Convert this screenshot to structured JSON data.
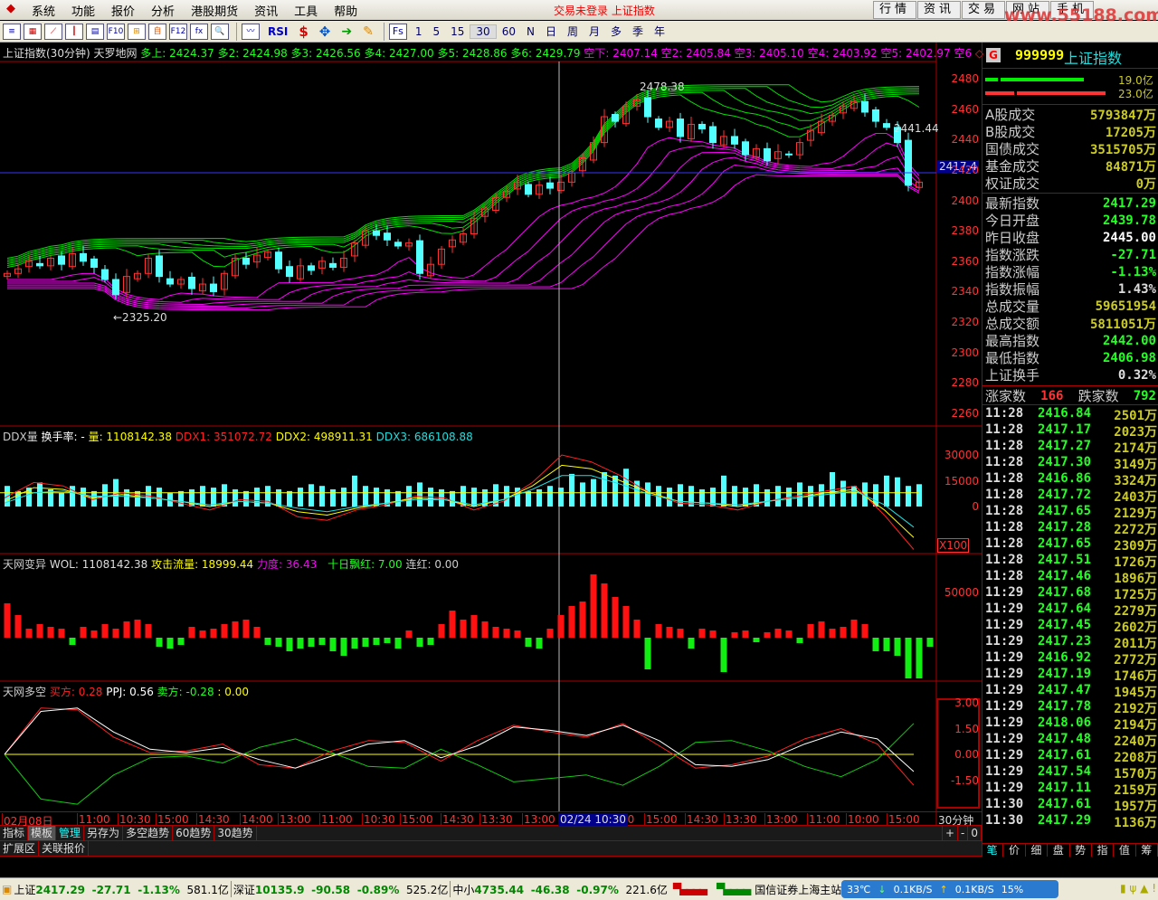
{
  "menu": {
    "items": [
      "系统",
      "功能",
      "报价",
      "分析",
      "港股期货",
      "资讯",
      "工具",
      "帮助"
    ],
    "warning": "交易未登录  上证指数",
    "nav": [
      "行情",
      "资讯",
      "交易",
      "网站",
      "手机"
    ],
    "watermark": "www.55188.com"
  },
  "toolbar": {
    "periods": [
      "1",
      "5",
      "15",
      "30",
      "60",
      "N",
      "日",
      "周",
      "月",
      "多",
      "季",
      "年"
    ],
    "selected_period": "30",
    "fs_label": "Fs",
    "rsi_label": "RSI"
  },
  "main_header": {
    "title": "上证指数(30分钟) 天罗地网",
    "bulls": [
      "多上: 2424.37",
      "多2: 2424.98",
      "多3: 2426.56",
      "多4: 2427.00",
      "多5: 2428.86",
      "多6: 2429.79"
    ],
    "bears": [
      "空下: 2407.14",
      "空2: 2405.84",
      "空3: 2405.10",
      "空4: 2403.92",
      "空5: 2402.97",
      "空6"
    ]
  },
  "ddx_header": {
    "name": "DDX量",
    "turnover": "换手率: -",
    "vol": "量: 1108142.38",
    "ddx1": "DDX1: 351072.72",
    "ddx2": "DDX2: 498911.31",
    "ddx3": "DDX3: 686108.88"
  },
  "wol_header": {
    "name": "天网变异",
    "wol": "WOL: 1108142.38",
    "attack": "攻击流量: 18999.44",
    "force": "力度: 36.43",
    "red10": "十日飘红: 7.00",
    "streak": "连红: 0.00"
  },
  "ppj_header": {
    "name": "天网多空",
    "buy": "买方: 0.28",
    "ppj": "PPJ: 0.56",
    "sell": "卖方: -0.28",
    "zero": ": 0.00"
  },
  "annotations": {
    "high": "2478.38",
    "low": "←2325.20",
    "right": "2441.44",
    "cursor_price": "2417.4"
  },
  "colors": {
    "up": "#ff3232",
    "down": "#54ffff",
    "bull": "#00e000",
    "bear": "#ff00ff",
    "axis": "#ff3333"
  },
  "chart_data": [
    {
      "type": "candlestick",
      "title": "上证指数(30分钟)",
      "y_ticks": [
        2480,
        2460,
        2440,
        2420,
        2400,
        2380,
        2360,
        2340,
        2320,
        2300,
        2280,
        2260
      ],
      "ylim": [
        2260,
        2480
      ],
      "close": [
        2352,
        2355,
        2360,
        2357,
        2362,
        2358,
        2365,
        2360,
        2356,
        2348,
        2338,
        2350,
        2352,
        2362,
        2350,
        2345,
        2348,
        2342,
        2345,
        2340,
        2352,
        2362,
        2358,
        2364,
        2366,
        2355,
        2350,
        2357,
        2354,
        2360,
        2356,
        2362,
        2372,
        2380,
        2377,
        2374,
        2370,
        2372,
        2352,
        2358,
        2368,
        2374,
        2378,
        2388,
        2395,
        2402,
        2406,
        2412,
        2404,
        2410,
        2408,
        2412,
        2418,
        2428,
        2438,
        2455,
        2452,
        2462,
        2466,
        2455,
        2448,
        2452,
        2442,
        2450,
        2447,
        2438,
        2442,
        2437,
        2430,
        2434,
        2426,
        2432,
        2430,
        2438,
        2446,
        2452,
        2456,
        2462,
        2465,
        2458,
        2452,
        2448,
        2438,
        2410,
        2412
      ]
    },
    {
      "type": "bar+line",
      "title": "DDX量",
      "y_ticks": [
        30000,
        15000,
        0
      ],
      "scale_label": "X100",
      "volume": [
        12000,
        9000,
        11000,
        14000,
        10000,
        8000,
        12000,
        11000,
        9000,
        13000,
        16000,
        10000,
        9000,
        12000,
        11000,
        8000,
        9000,
        10000,
        12000,
        11000,
        13000,
        10000,
        9000,
        11000,
        12000,
        10000,
        9000,
        11000,
        13000,
        12000,
        10000,
        11000,
        18000,
        12000,
        11000,
        10000,
        9000,
        12000,
        14000,
        11000,
        10000,
        9000,
        12000,
        11000,
        10000,
        13000,
        12000,
        11000,
        9000,
        10000,
        12000,
        11000,
        19000,
        14000,
        16000,
        20000,
        18000,
        22000,
        15000,
        14000,
        12000,
        11000,
        13000,
        12000,
        10000,
        11000,
        18000,
        12000,
        11000,
        13000,
        10000,
        12000,
        11000,
        14000,
        12000,
        13000,
        20000,
        15000,
        12000,
        14000,
        13000,
        18000,
        17000,
        12000,
        13000
      ],
      "ddx1": [
        5000,
        14000,
        12000,
        4000,
        8000,
        6000,
        2000,
        -2000,
        4000,
        3000,
        -6000,
        -8000,
        -2000,
        1000,
        6000,
        5000,
        -2000,
        3000,
        14000,
        30000,
        26000,
        18000,
        8000,
        2000,
        1000,
        -2000,
        3000,
        6000,
        9000,
        12000,
        -5000,
        -25000
      ],
      "ddx2": [
        3000,
        11000,
        10000,
        5000,
        7000,
        5000,
        3000,
        0,
        3000,
        2000,
        -3000,
        -5000,
        -1000,
        2000,
        5000,
        4000,
        0,
        4000,
        12000,
        24000,
        22000,
        15000,
        8000,
        3000,
        2000,
        0,
        3000,
        5000,
        8000,
        10000,
        -2000,
        -18000
      ],
      "ddx3": [
        2000,
        8000,
        9000,
        6000,
        6000,
        5000,
        3000,
        1000,
        3000,
        2000,
        -1000,
        -3000,
        0,
        2000,
        4000,
        4000,
        1000,
        4000,
        10000,
        18000,
        18000,
        13000,
        7000,
        3000,
        2000,
        1000,
        3000,
        5000,
        7000,
        9000,
        1000,
        -12000
      ],
      "ma_line": 8000
    },
    {
      "type": "bar",
      "title": "天网变异",
      "y_ticks": [
        50000
      ],
      "values": [
        38000,
        25000,
        10000,
        15000,
        12000,
        10000,
        -8000,
        12000,
        8000,
        15000,
        10000,
        18000,
        20000,
        15000,
        -10000,
        -12000,
        -8000,
        12000,
        8000,
        10000,
        15000,
        18000,
        20000,
        12000,
        -8000,
        -10000,
        -15000,
        -12000,
        -10000,
        -8000,
        -15000,
        -20000,
        -12000,
        -10000,
        -8000,
        -6000,
        -12000,
        8000,
        -10000,
        -8000,
        15000,
        30000,
        20000,
        25000,
        18000,
        12000,
        10000,
        8000,
        -10000,
        -12000,
        10000,
        25000,
        35000,
        40000,
        70000,
        60000,
        45000,
        35000,
        20000,
        -35000,
        15000,
        12000,
        10000,
        -12000,
        10000,
        8000,
        -38000,
        6000,
        8000,
        -5000,
        6000,
        10000,
        8000,
        -6000,
        15000,
        18000,
        10000,
        12000,
        20000,
        15000,
        -15000,
        -15000,
        -20000,
        -45000,
        -45000,
        -10000
      ]
    },
    {
      "type": "line",
      "title": "天网多空",
      "y_ticks": [
        3.0,
        1.5,
        0.0,
        -1.5
      ],
      "zero_line": 0,
      "buy": [
        0,
        2.7,
        2.6,
        1.0,
        0.1,
        0.2,
        0.6,
        -0.6,
        -0.8,
        0.2,
        0.8,
        0.7,
        -0.4,
        0.8,
        1.7,
        1.3,
        1.0,
        1.8,
        0.5,
        -0.8,
        -0.6,
        -0.1,
        0.9,
        1.5,
        0.6,
        -1.8
      ],
      "ppj": [
        0,
        2.5,
        2.7,
        1.3,
        0.3,
        0.1,
        0.4,
        -0.3,
        -0.8,
        -0.1,
        0.6,
        0.8,
        -0.2,
        0.5,
        1.6,
        1.4,
        1.1,
        1.7,
        0.8,
        -0.6,
        -0.7,
        -0.3,
        0.6,
        1.3,
        0.9,
        -1.0
      ],
      "sell": [
        0,
        -2.6,
        -2.9,
        -1.2,
        -0.2,
        -0.1,
        -0.5,
        0.4,
        0.9,
        0.1,
        -0.7,
        -0.8,
        0.3,
        -0.6,
        -1.6,
        -1.4,
        -1.2,
        -1.8,
        -0.7,
        0.7,
        0.8,
        0.2,
        -0.7,
        -1.3,
        -0.3,
        1.8
      ]
    }
  ],
  "time_axis": {
    "labels": [
      "02月08日",
      "11:00",
      "10:30",
      "15:00",
      "14:30",
      "14:00",
      "13:00",
      "11:00",
      "10:30",
      "15:00",
      "14:30",
      "13:30",
      "13:00",
      "00",
      "15:00",
      "14:30",
      "13:30",
      "13:00",
      "11:00",
      "10:00",
      "15:00"
    ],
    "cursor": "02/24 10:30",
    "period": "30分钟"
  },
  "bottom_tabs": {
    "row1": [
      "指标",
      "模板",
      "管理",
      "另存为",
      "多空趋势",
      "60趋势",
      "30趋势"
    ],
    "row2": [
      "扩展区",
      "关联报价"
    ],
    "zoom": [
      "+",
      "-",
      "0"
    ]
  },
  "right_panel": {
    "badge": "G",
    "code": "999999",
    "name": "上证指数",
    "bar_labels": [
      "19.0亿",
      "23.0亿"
    ],
    "volumes": [
      {
        "label": "A股成交",
        "value": "5793847万"
      },
      {
        "label": "B股成交",
        "value": "17205万"
      },
      {
        "label": "国债成交",
        "value": "3515705万"
      },
      {
        "label": "基金成交",
        "value": "84871万"
      },
      {
        "label": "权证成交",
        "value": "0万"
      }
    ],
    "stats": [
      {
        "label": "最新指数",
        "value": "2417.29",
        "color": "#2f2"
      },
      {
        "label": "今日开盘",
        "value": "2439.78",
        "color": "#2f2"
      },
      {
        "label": "昨日收盘",
        "value": "2445.00",
        "color": "#fff"
      },
      {
        "label": "指数涨跌",
        "value": "-27.71",
        "color": "#2f2"
      },
      {
        "label": "指数涨幅",
        "value": "-1.13%",
        "color": "#2f2"
      },
      {
        "label": "指数振幅",
        "value": "1.43%",
        "color": "#ddd"
      },
      {
        "label": "总成交量",
        "value": "59651954",
        "color": "#cc2"
      },
      {
        "label": "总成交额",
        "value": "5811051万",
        "color": "#cc2"
      },
      {
        "label": "最高指数",
        "value": "2442.00",
        "color": "#2f2"
      },
      {
        "label": "最低指数",
        "value": "2406.98",
        "color": "#2f2"
      },
      {
        "label": "上证换手",
        "value": "0.32%",
        "color": "#ddd"
      }
    ],
    "breadth": {
      "up_label": "涨家数",
      "up": "166",
      "down_label": "跌家数",
      "down": "792"
    },
    "ticks": [
      [
        "11:28",
        "2416.84",
        "2501万"
      ],
      [
        "11:28",
        "2417.17",
        "2023万"
      ],
      [
        "11:28",
        "2417.27",
        "2174万"
      ],
      [
        "11:28",
        "2417.30",
        "3149万"
      ],
      [
        "11:28",
        "2416.86",
        "3324万"
      ],
      [
        "11:28",
        "2417.72",
        "2403万"
      ],
      [
        "11:28",
        "2417.65",
        "2129万"
      ],
      [
        "11:28",
        "2417.28",
        "2272万"
      ],
      [
        "11:28",
        "2417.65",
        "2309万"
      ],
      [
        "11:28",
        "2417.51",
        "1726万"
      ],
      [
        "11:28",
        "2417.46",
        "1896万"
      ],
      [
        "11:29",
        "2417.68",
        "1725万"
      ],
      [
        "11:29",
        "2417.64",
        "2279万"
      ],
      [
        "11:29",
        "2417.45",
        "2602万"
      ],
      [
        "11:29",
        "2417.23",
        "2011万"
      ],
      [
        "11:29",
        "2416.92",
        "2772万"
      ],
      [
        "11:29",
        "2417.19",
        "1746万"
      ],
      [
        "11:29",
        "2417.47",
        "1945万"
      ],
      [
        "11:29",
        "2417.78",
        "2192万"
      ],
      [
        "11:29",
        "2418.06",
        "2194万"
      ],
      [
        "11:29",
        "2417.48",
        "2240万"
      ],
      [
        "11:29",
        "2417.61",
        "2208万"
      ],
      [
        "11:29",
        "2417.54",
        "1570万"
      ],
      [
        "11:29",
        "2417.11",
        "2159万"
      ],
      [
        "11:30",
        "2417.61",
        "1957万"
      ],
      [
        "11:30",
        "2417.29",
        "1136万"
      ]
    ],
    "tabs": [
      "笔",
      "价",
      "细",
      "盘",
      "势",
      "指",
      "值",
      "筹"
    ]
  },
  "status": {
    "sh": {
      "name": "上证",
      "price": "2417.29",
      "chg": "-27.71",
      "pct": "-1.13%",
      "amt": "581.1亿"
    },
    "sz": {
      "name": "深证",
      "price": "10135.9",
      "chg": "-90.58",
      "pct": "-0.89%",
      "amt": "525.2亿"
    },
    "zx": {
      "name": "中小",
      "price": "4735.44",
      "chg": "-46.38",
      "pct": "-0.97%",
      "amt": "221.6亿"
    },
    "server": "国信证券上海主站",
    "temp": "33℃",
    "down_speed": "0.1KB/S",
    "up_speed": "0.1KB/S",
    "cpu": "15%"
  }
}
